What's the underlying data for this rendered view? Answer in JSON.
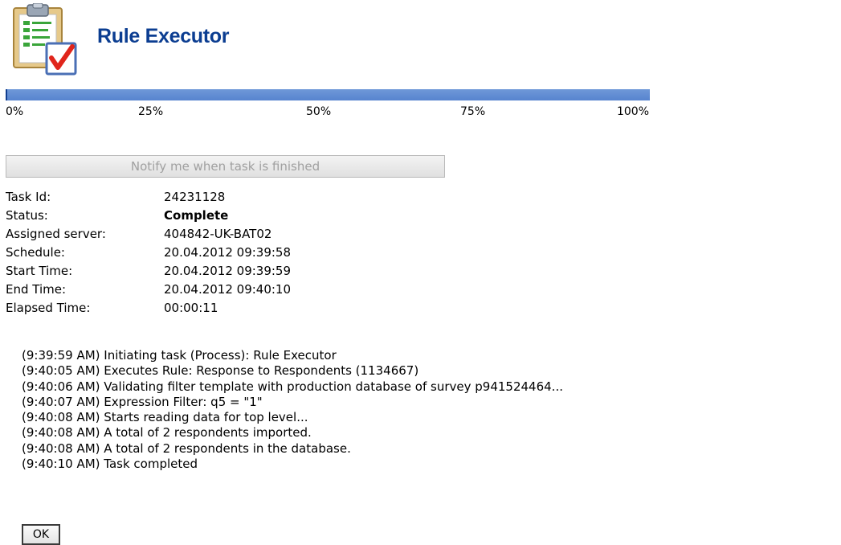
{
  "header": {
    "title": "Rule Executor",
    "icon": "clipboard-checklist-icon"
  },
  "progress": {
    "value_percent": 100,
    "labels": [
      "0%",
      "25%",
      "50%",
      "75%",
      "100%"
    ],
    "color": "#5b8ad3"
  },
  "notify_button": {
    "label": "Notify me when task is finished",
    "enabled": false
  },
  "task_info": [
    {
      "key": "Task Id:",
      "value": "24231128",
      "bold": false
    },
    {
      "key": "Status:",
      "value": "Complete",
      "bold": true
    },
    {
      "key": "Assigned server:",
      "value": "404842-UK-BAT02",
      "bold": false
    },
    {
      "key": "Schedule:",
      "value": "20.04.2012 09:39:58",
      "bold": false
    },
    {
      "key": "Start Time:",
      "value": "20.04.2012 09:39:59",
      "bold": false
    },
    {
      "key": "End Time:",
      "value": "20.04.2012 09:40:10",
      "bold": false
    },
    {
      "key": "Elapsed Time:",
      "value": "00:00:11",
      "bold": false
    }
  ],
  "log": [
    "(9:39:59 AM) Initiating task (Process): Rule Executor",
    "(9:40:05 AM) Executes Rule: Response to Respondents (1134667)",
    "(9:40:06 AM) Validating filter template with production database of survey p941524464...",
    "(9:40:07 AM) Expression Filter: q5 = \"1\"",
    "(9:40:08 AM) Starts reading data for top level...",
    "(9:40:08 AM) A total of 2 respondents imported.",
    "(9:40:08 AM) A total of 2 respondents in the database.",
    "(9:40:10 AM) Task completed"
  ],
  "ok_button": {
    "label": "OK"
  }
}
